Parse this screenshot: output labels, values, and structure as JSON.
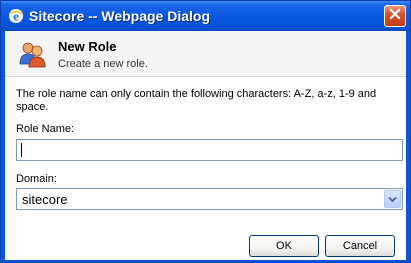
{
  "window": {
    "title": "Sitecore -- Webpage Dialog"
  },
  "header": {
    "title": "New Role",
    "subtitle": "Create a new role."
  },
  "form": {
    "info_text": "The role name can only contain the following characters: A-Z, a-z, 1-9 and space.",
    "role_name_label": "Role Name:",
    "role_name_value": "",
    "domain_label": "Domain:",
    "domain_value": "sitecore"
  },
  "buttons": {
    "ok_label": "OK",
    "cancel_label": "Cancel"
  },
  "colors": {
    "titlebar": "#0a58e0",
    "close_button": "#d8532d",
    "input_border": "#7f9db9",
    "button_border": "#003c74"
  },
  "icons": {
    "window": "ie-icon",
    "close": "close-icon",
    "role": "role-users-icon",
    "dropdown": "chevron-down-icon"
  }
}
